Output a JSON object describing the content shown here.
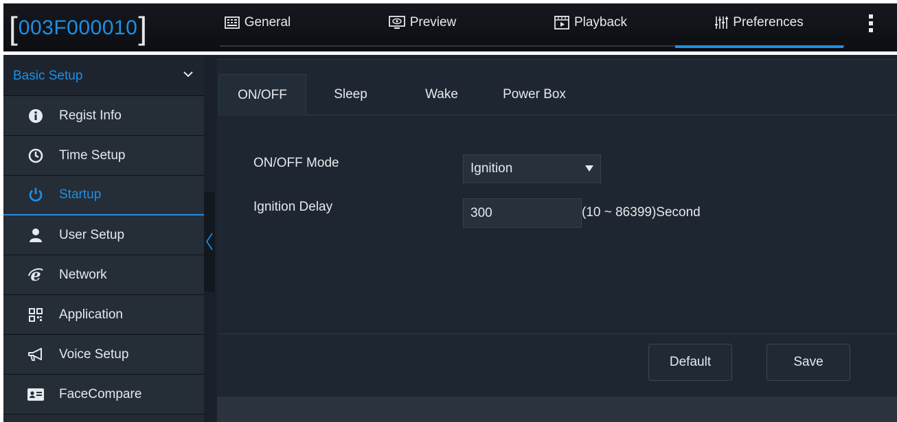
{
  "header": {
    "device_id": "003F000010",
    "tabs": [
      {
        "label": "General",
        "icon": "keyboard-icon"
      },
      {
        "label": "Preview",
        "icon": "monitor-eye-icon"
      },
      {
        "label": "Playback",
        "icon": "video-playback-icon"
      },
      {
        "label": "Preferences",
        "icon": "sliders-icon",
        "active": true
      }
    ],
    "menu_icon": "kebab-menu-icon"
  },
  "sidebar": {
    "section_title": "Basic Setup",
    "items": [
      {
        "label": "Regist Info",
        "icon": "info-icon"
      },
      {
        "label": "Time Setup",
        "icon": "clock-icon"
      },
      {
        "label": "Startup",
        "icon": "power-icon",
        "active": true
      },
      {
        "label": "User Setup",
        "icon": "user-icon"
      },
      {
        "label": "Network",
        "icon": "ie-icon"
      },
      {
        "label": "Application",
        "icon": "qr-icon"
      },
      {
        "label": "Voice Setup",
        "icon": "megaphone-icon"
      },
      {
        "label": "FaceCompare",
        "icon": "id-card-icon"
      }
    ]
  },
  "subtabs": [
    {
      "label": "ON/OFF",
      "active": true
    },
    {
      "label": "Sleep"
    },
    {
      "label": "Wake"
    },
    {
      "label": "Power Box"
    }
  ],
  "form": {
    "mode_label": "ON/OFF Mode",
    "mode_value": "Ignition",
    "delay_label": "Ignition Delay",
    "delay_value": "300",
    "delay_hint": "(10 ~ 86399)Second"
  },
  "buttons": {
    "default_label": "Default",
    "save_label": "Save"
  },
  "colors": {
    "accent": "#1e8fe6",
    "topbar_bg": "#0f1216",
    "sidebar_bg": "#252d37",
    "panel_bg": "#1e2731",
    "text": "#e6e9ee"
  }
}
